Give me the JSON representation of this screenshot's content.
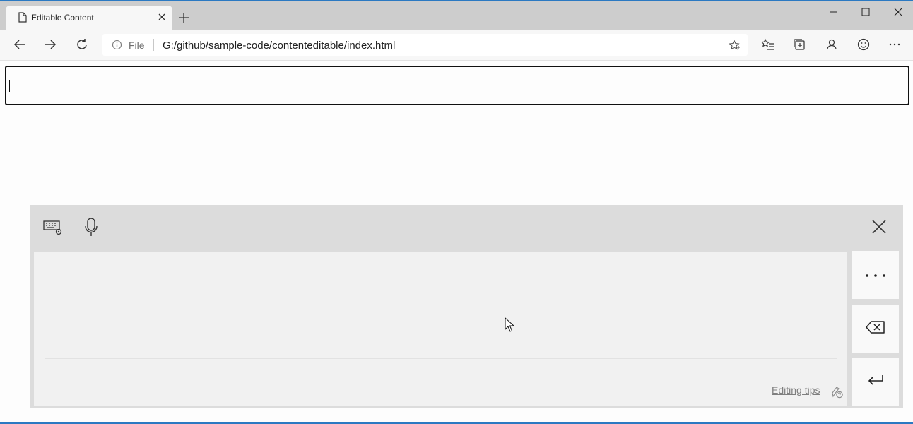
{
  "browser": {
    "tab": {
      "title": "Editable Content"
    },
    "address": {
      "scheme": "File",
      "url": "G:/github/sample-code/contenteditable/index.html"
    },
    "icons": [
      "page-icon",
      "close-icon",
      "plus-icon",
      "minimize-icon",
      "maximize-icon",
      "window-close-icon",
      "back-arrow-icon",
      "forward-arrow-icon",
      "refresh-icon",
      "info-icon",
      "star-icon",
      "favorites-icon",
      "collections-icon",
      "profile-icon",
      "emoji-icon",
      "more-icon"
    ]
  },
  "handwriting_panel": {
    "editing_tips": "Editing tips",
    "icons": [
      "keyboard-settings-icon",
      "microphone-icon",
      "close-icon",
      "more-dots-icon",
      "backspace-icon",
      "enter-icon",
      "pen-help-icon"
    ]
  },
  "colors": {
    "accent": "#2b79c2",
    "tabstrip": "#cdcdcd",
    "panel": "#dcdcdc",
    "writing_area": "#f1f1f1"
  }
}
